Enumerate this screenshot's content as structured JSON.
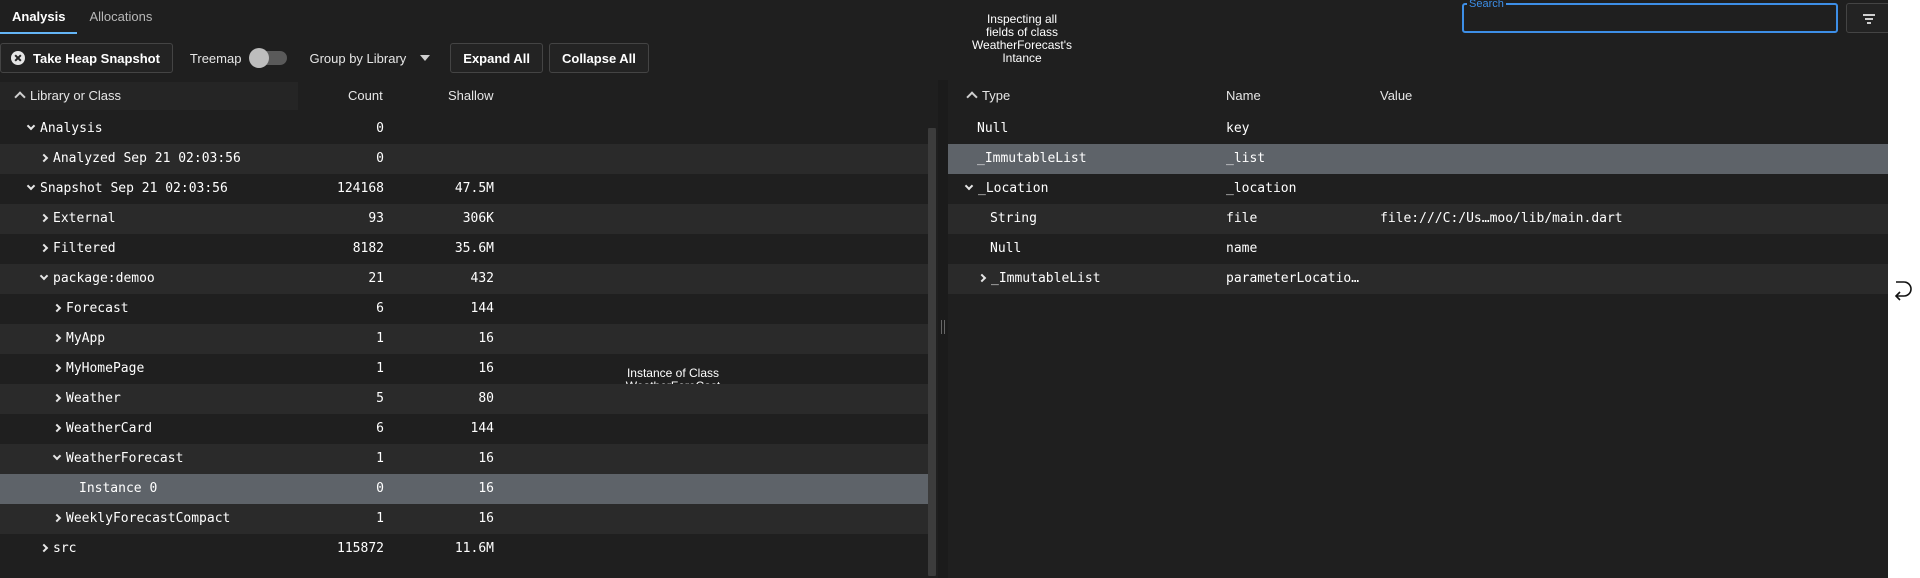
{
  "tabs": [
    {
      "label": "Analysis",
      "active": true
    },
    {
      "label": "Allocations",
      "active": false
    }
  ],
  "toolbar": {
    "snapshot_label": "Take Heap Snapshot",
    "treemap_label": "Treemap",
    "treemap_on": false,
    "group_by_label": "Group by Library",
    "expand_label": "Expand All",
    "collapse_label": "Collapse All"
  },
  "annotations": {
    "inspecting": "Inspecting all\nfields of class\nWeatherForecast's\nIntance",
    "instance": "Instance of Class\nWeatherForeCast"
  },
  "search": {
    "label": "Search",
    "value": ""
  },
  "left_table": {
    "headers": {
      "library": "Library or Class",
      "count": "Count",
      "shallow": "Shallow"
    },
    "rows": [
      {
        "name": "Analysis",
        "count": "0",
        "shallow": "",
        "indent": 0,
        "chevron": "down"
      },
      {
        "name": "Analyzed Sep 21 02:03:56",
        "count": "0",
        "shallow": "",
        "indent": 1,
        "chevron": "right"
      },
      {
        "name": "Snapshot Sep 21 02:03:56",
        "count": "124168",
        "shallow": "47.5M",
        "indent": 0,
        "chevron": "down"
      },
      {
        "name": "External",
        "count": "93",
        "shallow": "306K",
        "indent": 1,
        "chevron": "right"
      },
      {
        "name": "Filtered",
        "count": "8182",
        "shallow": "35.6M",
        "indent": 1,
        "chevron": "right"
      },
      {
        "name": "package:demoo",
        "count": "21",
        "shallow": "432",
        "indent": 1,
        "chevron": "down"
      },
      {
        "name": "Forecast",
        "count": "6",
        "shallow": "144",
        "indent": 2,
        "chevron": "right"
      },
      {
        "name": "MyApp",
        "count": "1",
        "shallow": "16",
        "indent": 2,
        "chevron": "right"
      },
      {
        "name": "MyHomePage",
        "count": "1",
        "shallow": "16",
        "indent": 2,
        "chevron": "right"
      },
      {
        "name": "Weather",
        "count": "5",
        "shallow": "80",
        "indent": 2,
        "chevron": "right"
      },
      {
        "name": "WeatherCard",
        "count": "6",
        "shallow": "144",
        "indent": 2,
        "chevron": "right"
      },
      {
        "name": "WeatherForecast",
        "count": "1",
        "shallow": "16",
        "indent": 2,
        "chevron": "down"
      },
      {
        "name": "Instance 0",
        "count": "0",
        "shallow": "16",
        "indent": 3,
        "chevron": "none",
        "selected": true
      },
      {
        "name": "WeeklyForecastCompact",
        "count": "1",
        "shallow": "16",
        "indent": 2,
        "chevron": "right"
      },
      {
        "name": "src",
        "count": "115872",
        "shallow": "11.6M",
        "indent": 1,
        "chevron": "right"
      }
    ]
  },
  "right_table": {
    "headers": {
      "type": "Type",
      "name": "Name",
      "value": "Value"
    },
    "rows": [
      {
        "type": "Null",
        "name": "key",
        "value": "",
        "indent": 0,
        "chevron": "none"
      },
      {
        "type": "_ImmutableList",
        "name": "_list",
        "value": "",
        "indent": 0,
        "chevron": "none",
        "selected": true
      },
      {
        "type": "_Location",
        "name": "_location",
        "value": "",
        "indent": 0,
        "chevron": "down"
      },
      {
        "type": "String",
        "name": "file",
        "value": "file:///C:/Us…moo/lib/main.dart",
        "indent": 1,
        "chevron": "none"
      },
      {
        "type": "Null",
        "name": "name",
        "value": "",
        "indent": 1,
        "chevron": "none"
      },
      {
        "type": "_ImmutableList",
        "name": "parameterLocatio…",
        "value": "",
        "indent": 1,
        "chevron": "right"
      }
    ]
  },
  "icons": {
    "snapshot": "close-circle-icon",
    "filter": "filter-icon",
    "sort": "sort-ascending-icon",
    "edge": "return-arrow-icon"
  },
  "colors": {
    "accent": "#3d8ee6",
    "selected_row": "#5e6369",
    "background": "#1f1f1f"
  }
}
